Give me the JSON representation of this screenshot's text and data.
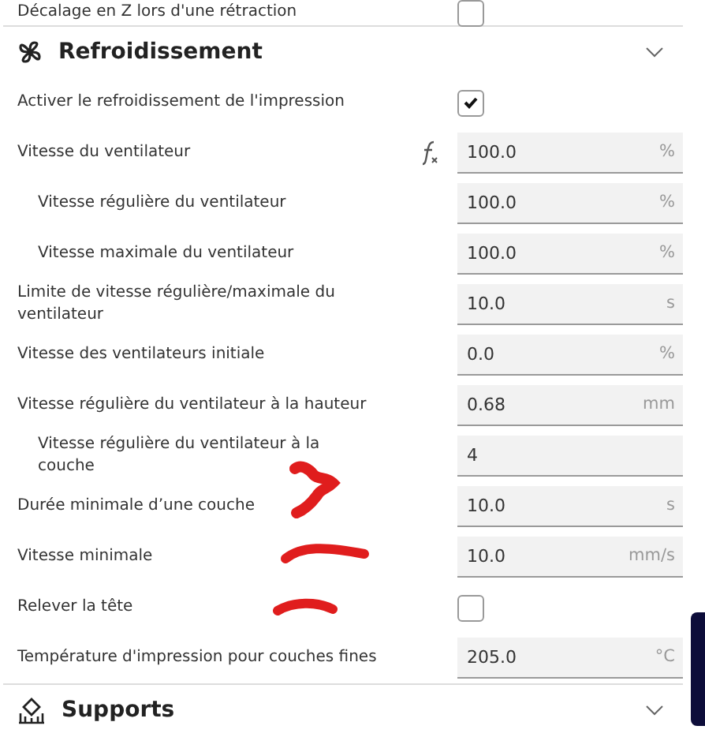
{
  "top_row": {
    "label": "Décalage en Z lors d'une rétraction",
    "checked": false
  },
  "sections": [
    {
      "kind": "fan",
      "title": "Refroidissement",
      "rows": [
        {
          "kind": "checkbox",
          "label": "Activer le refroidissement de l'impression",
          "checked": true
        },
        {
          "kind": "field",
          "label": "Vitesse du ventilateur",
          "formula": true,
          "value": "100.0",
          "unit": "%",
          "children": [
            {
              "kind": "field",
              "label": "Vitesse régulière du ventilateur",
              "value": "100.0",
              "unit": "%"
            },
            {
              "kind": "field",
              "label": "Vitesse maximale du ventilateur",
              "value": "100.0",
              "unit": "%"
            }
          ]
        },
        {
          "kind": "field",
          "label": "Limite de vitesse régulière/maximale du ventilateur",
          "value": "10.0",
          "unit": "s"
        },
        {
          "kind": "field",
          "label": "Vitesse des ventilateurs initiale",
          "value": "0.0",
          "unit": "%"
        },
        {
          "kind": "field",
          "label": "Vitesse régulière du ventilateur à la hauteur",
          "value": "0.68",
          "unit": "mm",
          "children": [
            {
              "kind": "field",
              "label": "Vitesse régulière du ventilateur à la couche",
              "value": "4"
            }
          ]
        },
        {
          "kind": "field",
          "label": "Durée minimale d’une couche",
          "value": "10.0",
          "unit": "s"
        },
        {
          "kind": "field",
          "label": "Vitesse minimale",
          "value": "10.0",
          "unit": "mm/s"
        },
        {
          "kind": "checkbox",
          "label": "Relever la tête",
          "checked": false
        },
        {
          "kind": "field",
          "label": "Température d'impression pour couches fines",
          "value": "205.0",
          "unit": "°C"
        }
      ]
    },
    {
      "kind": "support",
      "title": "Supports"
    }
  ]
}
